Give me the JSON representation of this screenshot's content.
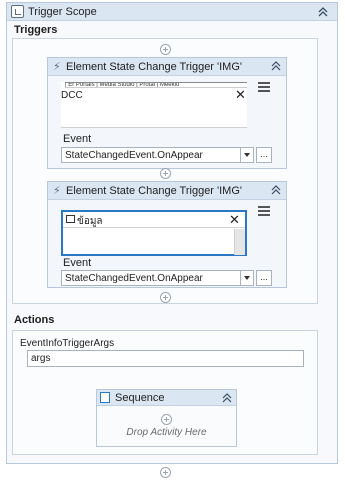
{
  "scope": {
    "title": "Trigger Scope"
  },
  "triggers": {
    "label": "Triggers",
    "items": [
      {
        "title": "Element State Change Trigger 'IMG'",
        "thumb_strip": "| Er Portals | Media Studio | Protal | Meekio",
        "thumb_text": "DCC",
        "event_label": "Event",
        "event_value": "StateChangedEvent.OnAppear",
        "dots": "..."
      },
      {
        "title": "Element State Change Trigger 'IMG'",
        "thumb_text": "ข้อมูล",
        "event_label": "Event",
        "event_value": "StateChangedEvent.OnAppear",
        "dots": "..."
      }
    ]
  },
  "actions": {
    "label": "Actions",
    "arg_label": "EventInfoTriggerArgs",
    "arg_value": "args",
    "sequence": {
      "title": "Sequence",
      "drop_text": "Drop Activity Here"
    }
  },
  "icons": {
    "collapse": "double-chevron-up-icon",
    "add": "plus-circle-icon",
    "trigger": "lightning-icon",
    "menu": "hamburger-menu-icon"
  }
}
